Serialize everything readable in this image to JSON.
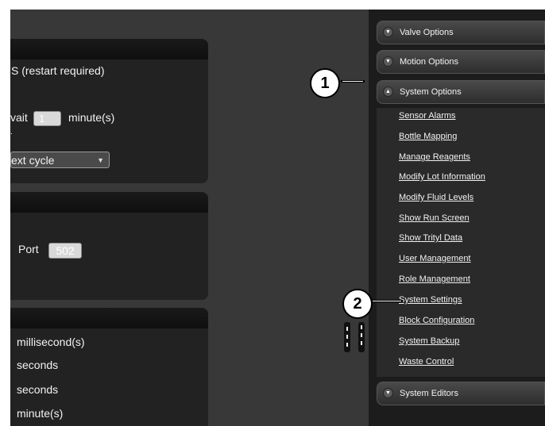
{
  "left_panel_1": {
    "restart_text": "S  (restart required)",
    "wait_prefix": "vait",
    "wait_value": "1",
    "wait_unit": "minute(s)",
    "dot": ".",
    "cycle_select": "ext cycle"
  },
  "left_panel_2": {
    "port_label": "Port",
    "port_value": "502"
  },
  "left_panel_3": {
    "units": [
      "millisecond(s)",
      "seconds",
      "seconds",
      "minute(s)"
    ]
  },
  "menu": {
    "headers": {
      "valve": "Valve Options",
      "motion": "Motion Options",
      "system": "System Options",
      "editors": "System Editors"
    },
    "system_items": [
      "Sensor Alarms",
      "Bottle Mapping",
      "Manage Reagents",
      "Modify Lot Information",
      "Modify Fluid Levels",
      "Show Run Screen",
      "Show Trityl Data",
      "User Management",
      "Role Management",
      "System Settings",
      "Block Configuration",
      "System Backup",
      "Waste Control"
    ]
  },
  "callouts": [
    "1",
    "2"
  ],
  "icons": {
    "collapsed": "chevron-down-icon",
    "expanded": "chevron-up-icon"
  }
}
